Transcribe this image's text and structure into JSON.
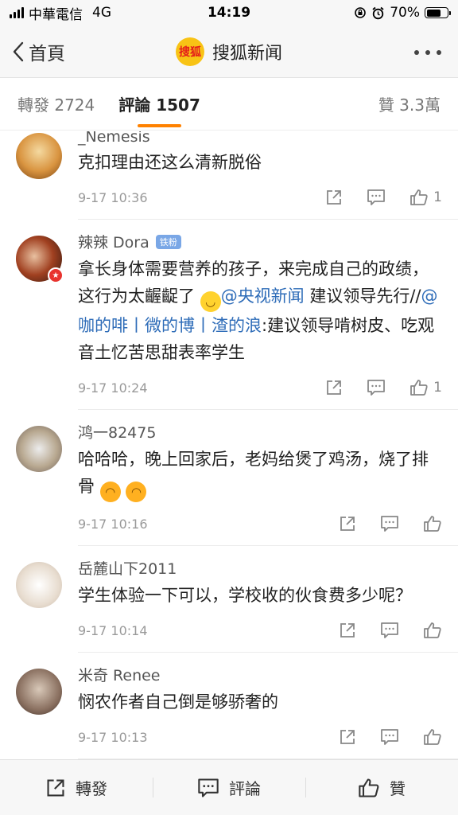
{
  "status_bar": {
    "carrier": "中華電信",
    "network": "4G",
    "time": "14:19",
    "battery": "70%",
    "battery_level": 0.7
  },
  "nav": {
    "back_label": "首頁",
    "logo_text": "搜狐",
    "title": "搜狐新闻"
  },
  "tabs": {
    "reposts": "轉發 2724",
    "comments": "評論 1507",
    "likes": "贊 3.3萬"
  },
  "comments": [
    {
      "user": "_Nemesis",
      "text": "克扣理由还这么清新脱俗",
      "time": "9-17 10:36",
      "likes": "1"
    },
    {
      "user": "辣辣 Dora",
      "badge": "铁粉",
      "text_a": "拿长身体需要营养的孩子，来完成自己的政绩，这行为太齷齪了 ",
      "mention1": "@央视新闻",
      "text_b": " 建议领导先行//",
      "mention2": "@咖的啡丨微的博丨渣的浪",
      "text_c": ":建议领导啃树皮、吃观音土忆苦思甜表率学生",
      "time": "9-17 10:24",
      "likes": "1"
    },
    {
      "user": "鸿一82475",
      "text": "哈哈哈，晚上回家后，老妈给煲了鸡汤，烧了排骨",
      "time": "9-17 10:16",
      "likes": ""
    },
    {
      "user": "岳麓山下2011",
      "text": "学生体验一下可以，学校收的伙食费多少呢？",
      "time": "9-17 10:14",
      "likes": ""
    },
    {
      "user": "米奇 Renee",
      "text": "悯农作者自己倒是够骄奢的",
      "time": "9-17 10:13",
      "likes": ""
    }
  ],
  "toolbar": {
    "repost": "轉發",
    "comment": "評論",
    "like": "贊"
  }
}
